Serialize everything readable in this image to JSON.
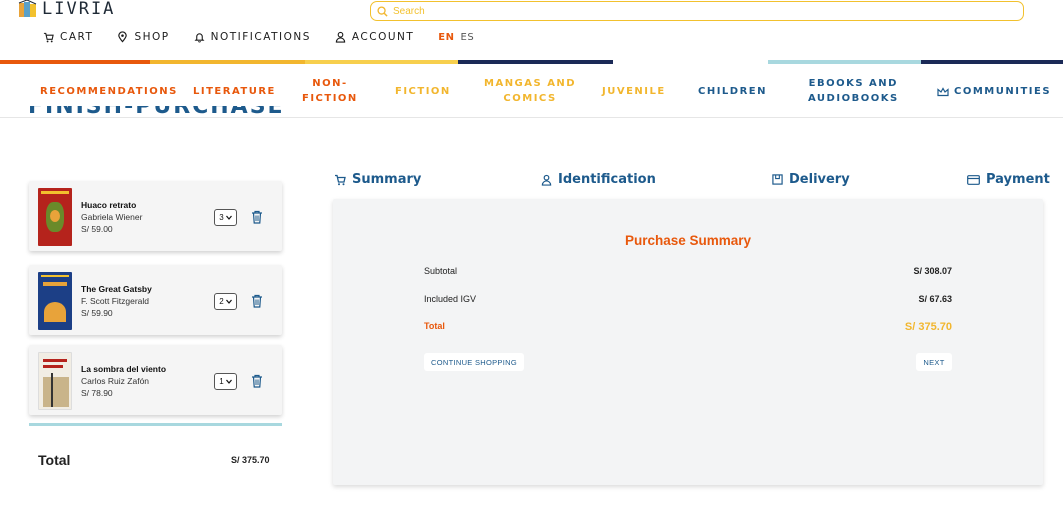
{
  "brand": {
    "name": "LIVRIA",
    "icon": "books-logo-icon"
  },
  "search": {
    "placeholder": "Search",
    "value": ""
  },
  "topnav": {
    "cart": "CART",
    "shop": "SHOP",
    "notifications": "NOTIFICATIONS",
    "account": "ACCOUNT",
    "lang_en": "EN",
    "lang_es": "ES"
  },
  "colors": {
    "orange": "#e8580c",
    "yellow": "#f2c12e",
    "navy": "#1b2a57",
    "teal": "#a8d8df",
    "blue": "#1d5a8c"
  },
  "categories": {
    "recommendations": "RECOMMENDATIONS",
    "literature": "LITERATURE",
    "nonfiction_1": "NON-",
    "nonfiction_2": "FICTION",
    "fiction": "FICTION",
    "mangas_1": "MANGAS AND",
    "mangas_2": "COMICS",
    "juvenile": "JUVENILE",
    "children": "CHILDREN",
    "ebooks_1": "EBOOKS AND",
    "ebooks_2": "AUDIOBOOKS",
    "communities": "COMMUNITIES"
  },
  "page": {
    "title": "FINISH-PURCHASE"
  },
  "cart": {
    "items": [
      {
        "title": "Huaco retrato",
        "author": "Gabriela Wiener",
        "price": "S/ 59.00",
        "qty": "3"
      },
      {
        "title": "The Great Gatsby",
        "author": "F. Scott Fitzgerald",
        "price": "S/ 59.90",
        "qty": "2"
      },
      {
        "title": "La sombra del viento",
        "author": "Carlos Ruiz Zafón",
        "price": "S/ 78.90",
        "qty": "1"
      }
    ],
    "total_label": "Total",
    "total_value": "S/ 375.70"
  },
  "steps": {
    "summary": "Summary",
    "identification": "Identification",
    "delivery": "Delivery",
    "payment": "Payment"
  },
  "summary": {
    "title": "Purchase Summary",
    "subtotal_label": "Subtotal",
    "subtotal_value": "S/ 308.07",
    "igv_label": "Included IGV",
    "igv_value": "S/ 67.63",
    "total_label": "Total",
    "total_value": "S/ 375.70",
    "continue_label": "CONTINUE SHOPPING",
    "next_label": "NEXT"
  }
}
